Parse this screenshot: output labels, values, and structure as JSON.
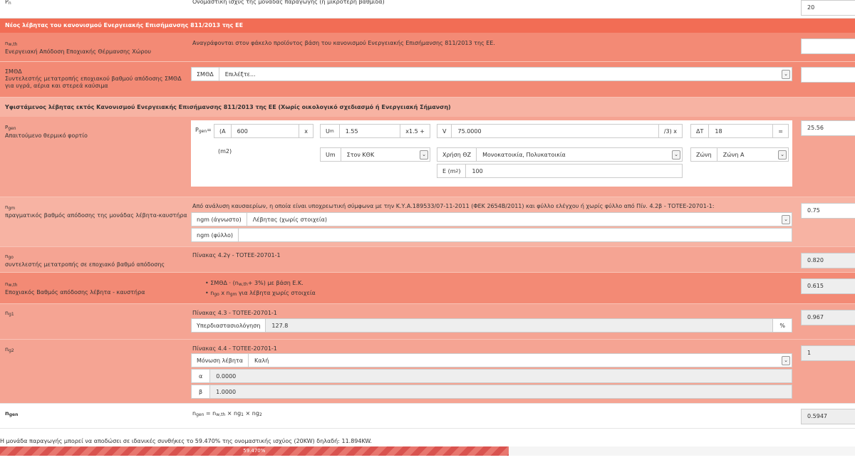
{
  "pn_row": {
    "symbol": "P",
    "symbol_sub": "n",
    "description": "Ονομαστική ισχύς της μονάδας παραγωγής (η μικρότερη βαθμίδα)",
    "value": "20"
  },
  "new_boiler_header": "Νέος λέβητας του κανονισμού Ενεργειακής Επισήμανσης 811/2013 της ΕΕ",
  "nwth_row": {
    "symbol": "n",
    "symbol_sub": "w,th",
    "label": "Ενεργειακή Απόδοση Εποχιακής Θέρμανσης Χώρου",
    "description": "Αναγράφονται στον φάκελο προϊόντος βάση του κανονισμού Ενεργειακής Επισήμανσης 811/2013 της ΕΕ.",
    "value": ""
  },
  "smod_row": {
    "symbol": "ΣΜΘΔ",
    "label_line1": "Συντελεστής μετατροπής εποχιακού βαθμού απόδοσης ΣΜΘΔ",
    "label_line2": "για υγρά, αέρια και στερεά καύσιμα",
    "addon": "ΣΜΘΔ",
    "select_value": "Επιλέξτε...",
    "value": ""
  },
  "existing_boiler_header": "Υφιστάμενος λέβητας εκτός Κανονισμού Ενεργειακής Επισήμανσης 811/2013 της ΕΕ (Χωρίς οικολογικό σχεδιασμό ή Ενεργειακή Σήμανση)",
  "pgen_row": {
    "symbol": "P",
    "symbol_sub": "gen",
    "label": "Απαιτούμενο θερμικό φορτίο",
    "formula_label": "P",
    "formula_sub": "gen",
    "formula_eq": "=",
    "a_prefix": "(A",
    "a_value": "600",
    "a_suffix": "x",
    "um_label": "U",
    "um_sub": "m",
    "um_value": "1.55",
    "um_suffix": "x1.5 +",
    "v_label": "V",
    "v_value": "75.0000",
    "v_suffix": "/3) x",
    "dt_label": "ΔT",
    "dt_value": "18",
    "dt_suffix": "=",
    "m2_label": "(m2)",
    "um_select_label": "Um",
    "um_select_value": "Στον ΚΘΚ",
    "use_label": "Χρήση ΘΖ",
    "use_value": "Μονοκατοικία, Πολυκατοικία",
    "zone_label": "Ζώνη",
    "zone_value": "Ζώνη Α",
    "e_label": "E (m",
    "e_sup": "2",
    "e_label_end": ")",
    "e_value": "100",
    "value": "25.56"
  },
  "ngm_row": {
    "symbol": "n",
    "symbol_sub": "gm",
    "label": "πραγματικός βαθμός απόδοσης της μονάδας λέβητα-καυστήρα",
    "description": "Από ανάλυση καυσαερίων, η οποία είναι υποχρεωτική σύμφωνα με την Κ.Υ.Α.189533/07-11-2011 (ΦΕΚ 2654Β/2011) και φύλλο ελέγχου ή χωρίς φύλλο από Πίν. 4.2β - ΤΟΤΕΕ-20701-1:",
    "unknown_addon": "ngm (άγνωστο)",
    "unknown_value": "Λέβητας (χωρίς στοιχεία)",
    "sheet_addon": "ngm (φύλλο)",
    "sheet_value": "",
    "value": "0.75"
  },
  "ngo_row": {
    "symbol": "n",
    "symbol_sub": "go",
    "label": "συντελεστής μετατροπής σε εποχιακό βαθμό απόδοσης",
    "description": "Πίνακας 4.2γ - ΤΟΤΕΕ-20701-1",
    "value": "0.820"
  },
  "nwth2_row": {
    "symbol": "n",
    "symbol_sub": "w,th",
    "label": "Εποχιακός Βαθμός απόδοσης λέβητα - καυστήρα",
    "bullet1_pre": "ΣΜΘΔ · (n",
    "bullet1_sub": "w,th",
    "bullet1_post": "+ 3%) με βάση Ε.Κ.",
    "bullet2_a": "n",
    "bullet2_a_sub": "go",
    "bullet2_mid": " x n",
    "bullet2_b_sub": "gm",
    "bullet2_post": " για λέβητα χωρίς στοιχεία",
    "value": "0.615"
  },
  "ng1_row": {
    "symbol": "n",
    "symbol_sub": "g1",
    "description": "Πίνακας 4.3 - ΤΟΤΕΕ-20701-1",
    "addon": "Υπερδιαστασιολόγηση",
    "field_value": "127.8",
    "suffix": "%",
    "value": "0.967"
  },
  "ng2_row": {
    "symbol": "n",
    "symbol_sub": "g2",
    "description": "Πίνακας 4.4 - ΤΟΤΕΕ-20701-1",
    "insulation_addon": "Μόνωση λέβητα",
    "insulation_value": "Καλή",
    "alpha_addon": "α",
    "alpha_value": "0.0000",
    "beta_addon": "β",
    "beta_value": "1.0000",
    "value": "1"
  },
  "ngen_row": {
    "symbol": "n",
    "symbol_sub": "gen",
    "formula": "n",
    "formula_sub1": "gen",
    "formula_eq": " = n",
    "formula_sub2": "w,th",
    "formula_x1": " × ng",
    "formula_sub3": "1",
    "formula_x2": " × ng",
    "formula_sub4": "2",
    "value": "0.5947"
  },
  "summary_text": "Η μονάδα παραγωγής μπορεί να αποδώσει σε ιδανικές συνθήκες το 59.470% της ονομαστικής ισχύος (20KW) δηλαδή: 11.894KW.",
  "progress": {
    "label": "59.470%",
    "fraction": 0.5947,
    "color": "#d9534f"
  },
  "colors": {
    "row_light": "#f7b3a3",
    "row_medium": "#f5a493",
    "row_dark": "#f38a75",
    "header": "#f26d55"
  }
}
